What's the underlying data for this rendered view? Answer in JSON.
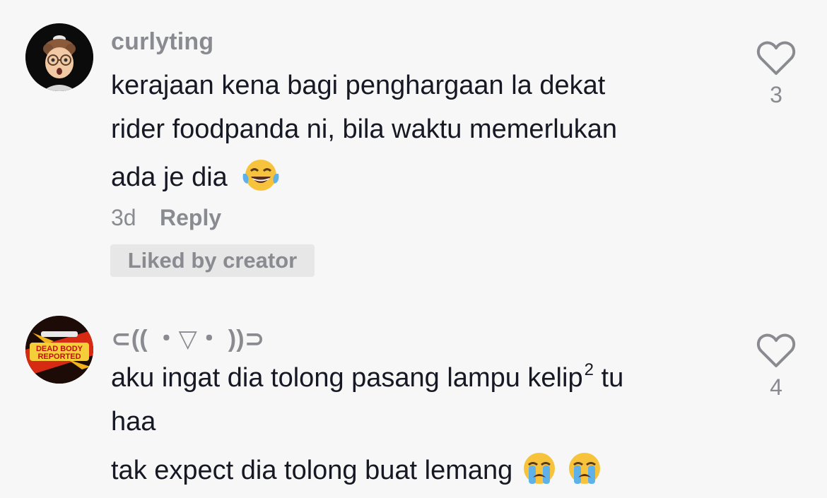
{
  "comments": [
    {
      "username": "curlyting",
      "lines": [
        "kerajaan kena bagi penghargaan la dekat",
        "rider foodpanda ni, bila waktu memerlukan",
        "ada je dia"
      ],
      "emoji": "face-with-tears-of-joy-icon",
      "time": "3d",
      "reply_label": "Reply",
      "badge": "Liked by creator",
      "likes": "3"
    },
    {
      "username": "⊂(( ・▽・ ))⊃",
      "line1": "aku ingat dia tolong pasang lampu kelip",
      "line1_sup": "2",
      "line1_tail": " tu",
      "line2": "haa",
      "line3": "tak expect dia tolong buat lemang",
      "emoji": "loudly-crying-face-icon",
      "avatar_text_1": "DEAD BODY",
      "avatar_text_2": "REPORTED",
      "likes": "4"
    }
  ]
}
